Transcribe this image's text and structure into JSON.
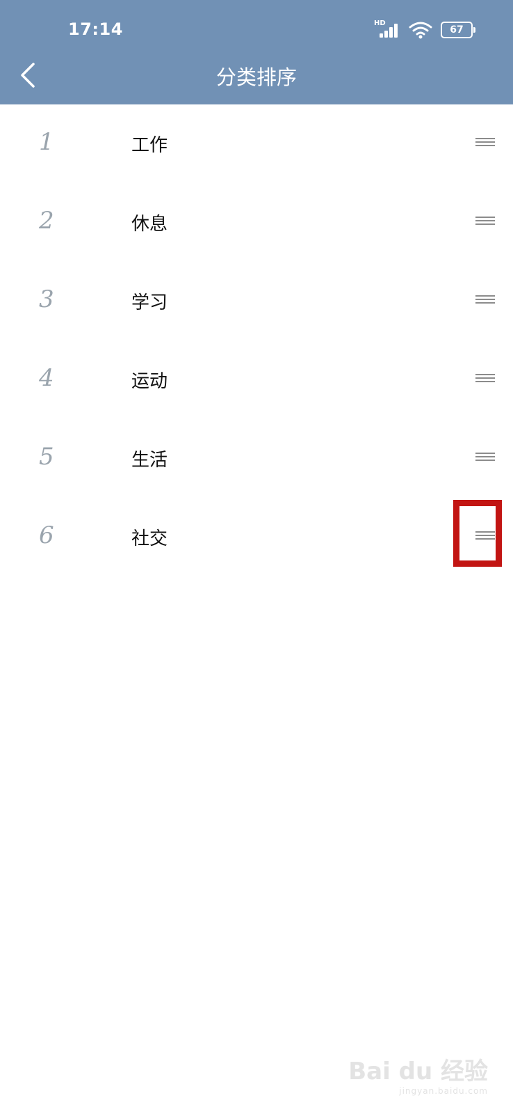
{
  "status_bar": {
    "time": "17:14",
    "network": "HD",
    "battery": "67"
  },
  "header": {
    "title": "分类排序",
    "back_icon": "chevron-left-icon"
  },
  "categories": [
    {
      "index": "1",
      "label": "工作"
    },
    {
      "index": "2",
      "label": "休息"
    },
    {
      "index": "3",
      "label": "学习"
    },
    {
      "index": "4",
      "label": "运动"
    },
    {
      "index": "5",
      "label": "生活"
    },
    {
      "index": "6",
      "label": "社交"
    }
  ],
  "drag_icon": "drag-handle-icon",
  "colors": {
    "header_bg": "#7191b5",
    "highlight": "#c21513",
    "number_gray": "#9aa4ad"
  },
  "watermark": {
    "text": "Bai du 经验",
    "url": "jingyan.baidu.com"
  }
}
